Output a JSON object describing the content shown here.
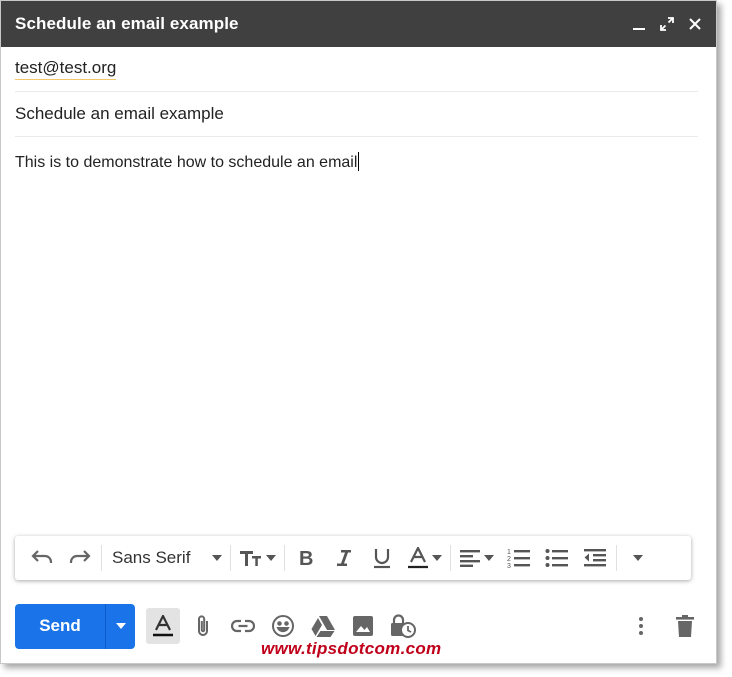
{
  "window": {
    "title": "Schedule an email example",
    "controls": [
      "minimize-icon",
      "expand-icon",
      "close-icon"
    ]
  },
  "compose": {
    "to": "test@test.org",
    "subject": "Schedule an email example",
    "body": "This is to demonstrate how to schedule an email"
  },
  "formatting": {
    "font": "Sans Serif",
    "tools": [
      "undo-icon",
      "redo-icon",
      "font-size-icon",
      "bold-icon",
      "italic-icon",
      "underline-icon",
      "text-color-icon",
      "align-icon",
      "numbered-list-icon",
      "bulleted-list-icon",
      "indent-less-icon",
      "more-formatting-icon"
    ]
  },
  "actions": {
    "send_label": "Send",
    "tools": [
      "formatting-options-icon",
      "attach-icon",
      "link-icon",
      "emoji-icon",
      "drive-icon",
      "photo-icon",
      "confidential-mode-icon",
      "more-options-icon",
      "discard-icon"
    ]
  },
  "watermark": "www.tipsdotcom.com",
  "colors": {
    "titlebar": "#404040",
    "send": "#1a73e8",
    "watermark": "#c0001a"
  }
}
